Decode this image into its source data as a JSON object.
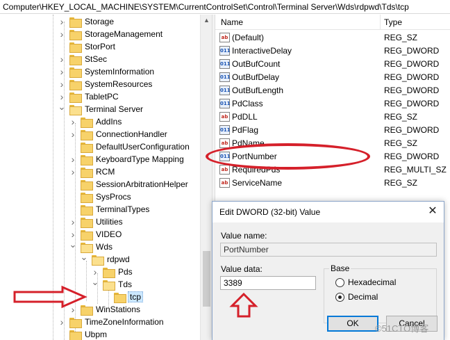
{
  "address_bar": {
    "path": "Computer\\HKEY_LOCAL_MACHINE\\SYSTEM\\CurrentControlSet\\Control\\Terminal Server\\Wds\\rdpwd\\Tds\\tcp"
  },
  "tree": {
    "items": [
      {
        "label": "Storage",
        "expandable": true,
        "expanded": false
      },
      {
        "label": "StorageManagement",
        "expandable": true,
        "expanded": false
      },
      {
        "label": "StorPort",
        "expandable": false,
        "expanded": false
      },
      {
        "label": "StSec",
        "expandable": true,
        "expanded": false
      },
      {
        "label": "SystemInformation",
        "expandable": true,
        "expanded": false
      },
      {
        "label": "SystemResources",
        "expandable": true,
        "expanded": false
      },
      {
        "label": "TabletPC",
        "expandable": true,
        "expanded": false
      },
      {
        "label": "Terminal Server",
        "expandable": true,
        "expanded": true
      },
      {
        "label": "AddIns",
        "expandable": true,
        "expanded": false
      },
      {
        "label": "ConnectionHandler",
        "expandable": true,
        "expanded": false
      },
      {
        "label": "DefaultUserConfiguration",
        "expandable": false,
        "expanded": false
      },
      {
        "label": "KeyboardType Mapping",
        "expandable": true,
        "expanded": false
      },
      {
        "label": "RCM",
        "expandable": true,
        "expanded": false
      },
      {
        "label": "SessionArbitrationHelper",
        "expandable": false,
        "expanded": false
      },
      {
        "label": "SysProcs",
        "expandable": false,
        "expanded": false
      },
      {
        "label": "TerminalTypes",
        "expandable": false,
        "expanded": false
      },
      {
        "label": "Utilities",
        "expandable": true,
        "expanded": false
      },
      {
        "label": "VIDEO",
        "expandable": true,
        "expanded": false
      },
      {
        "label": "Wds",
        "expandable": true,
        "expanded": true
      },
      {
        "label": "rdpwd",
        "expandable": true,
        "expanded": true
      },
      {
        "label": "Pds",
        "expandable": true,
        "expanded": false
      },
      {
        "label": "Tds",
        "expandable": true,
        "expanded": true
      },
      {
        "label": "tcp",
        "expandable": false,
        "expanded": false,
        "selected": true
      },
      {
        "label": "WinStations",
        "expandable": true,
        "expanded": false
      },
      {
        "label": "TimeZoneInformation",
        "expandable": true,
        "expanded": false
      },
      {
        "label": "Ubpm",
        "expandable": false,
        "expanded": false
      }
    ]
  },
  "values_pane": {
    "col_name": "Name",
    "col_type": "Type",
    "rows": [
      {
        "icon": "string-value-icon",
        "icon_text": "ab",
        "name": "(Default)",
        "type": "REG_SZ"
      },
      {
        "icon": "dword-value-icon",
        "icon_text": "011",
        "name": "InteractiveDelay",
        "type": "REG_DWORD"
      },
      {
        "icon": "dword-value-icon",
        "icon_text": "011",
        "name": "OutBufCount",
        "type": "REG_DWORD"
      },
      {
        "icon": "dword-value-icon",
        "icon_text": "011",
        "name": "OutBufDelay",
        "type": "REG_DWORD"
      },
      {
        "icon": "dword-value-icon",
        "icon_text": "011",
        "name": "OutBufLength",
        "type": "REG_DWORD"
      },
      {
        "icon": "dword-value-icon",
        "icon_text": "011",
        "name": "PdClass",
        "type": "REG_DWORD"
      },
      {
        "icon": "string-value-icon",
        "icon_text": "ab",
        "name": "PdDLL",
        "type": "REG_SZ"
      },
      {
        "icon": "dword-value-icon",
        "icon_text": "011",
        "name": "PdFlag",
        "type": "REG_DWORD"
      },
      {
        "icon": "string-value-icon",
        "icon_text": "ab",
        "name": "PdName",
        "type": "REG_SZ"
      },
      {
        "icon": "dword-value-icon",
        "icon_text": "011",
        "name": "PortNumber",
        "type": "REG_DWORD"
      },
      {
        "icon": "string-value-icon",
        "icon_text": "ab",
        "name": "RequiredPds",
        "type": "REG_MULTI_SZ"
      },
      {
        "icon": "string-value-icon",
        "icon_text": "ab",
        "name": "ServiceName",
        "type": "REG_SZ"
      }
    ]
  },
  "dialog": {
    "title": "Edit DWORD (32-bit) Value",
    "value_name_label": "Value name:",
    "value_name": "PortNumber",
    "value_data_label": "Value data:",
    "value_data": "3389",
    "base_label": "Base",
    "hex_label": "Hexadecimal",
    "dec_label": "Decimal",
    "selected_base": "Decimal",
    "ok_label": "OK",
    "cancel_label": "Cancel"
  },
  "watermark": "©51CTO博客",
  "colors": {
    "annotation_red": "#d5202a",
    "selection": "#cce8ff",
    "folder": "#f7d26a"
  }
}
